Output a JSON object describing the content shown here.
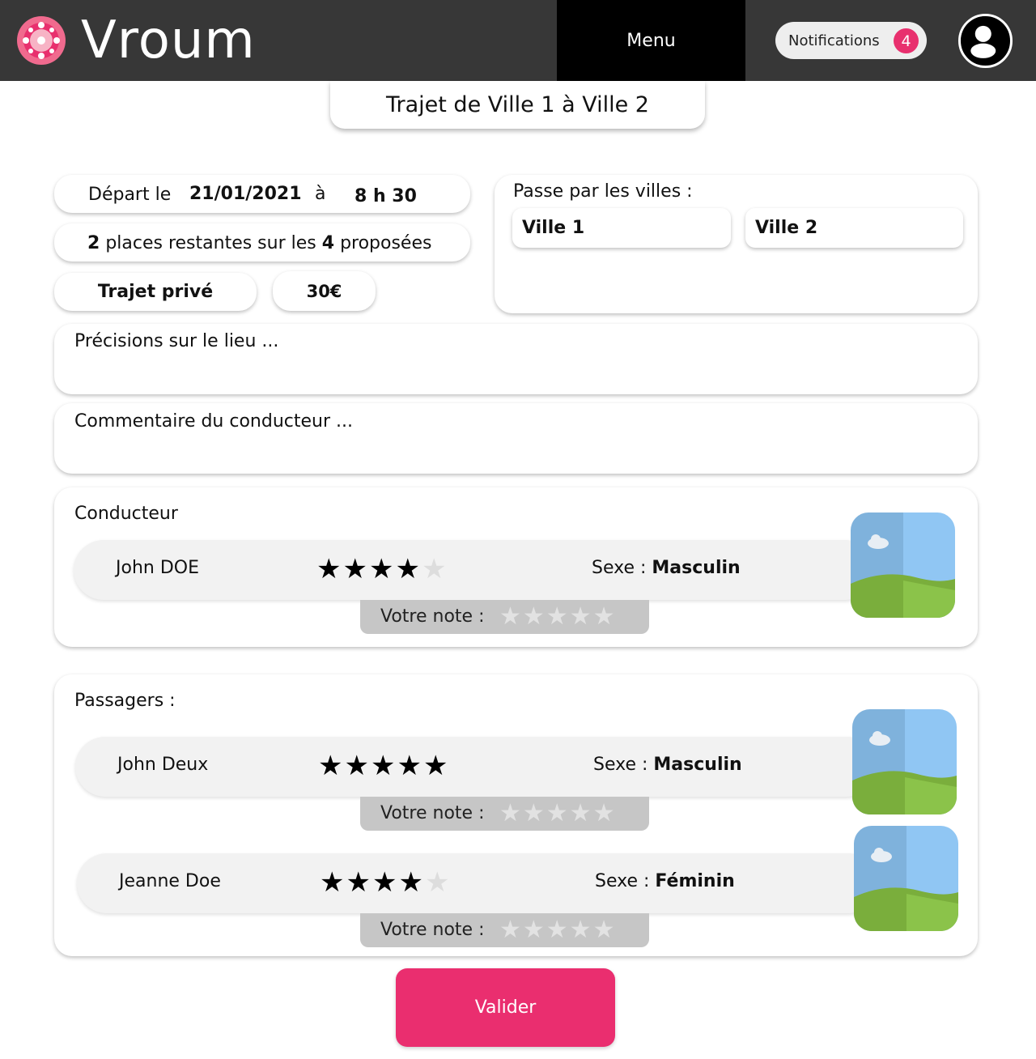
{
  "header": {
    "app_name": "Vroum",
    "menu_label": "Menu",
    "notifications_label": "Notifications",
    "notifications_count": "4",
    "accent_color": "#ea2e6f"
  },
  "trip": {
    "title": "Trajet de Ville 1 à Ville 2",
    "departure_label": "Départ le",
    "departure_date": "21/01/2021",
    "at_label": "à",
    "departure_time": "8 h 30",
    "seats_remaining": "2",
    "seats_text_1": "places restantes sur les",
    "seats_total": "4",
    "seats_text_2": "proposées",
    "privacy": "Trajet privé",
    "price": "30€",
    "cities_label": "Passe par les villes :",
    "cities": [
      "Ville 1",
      "Ville 2"
    ],
    "location_details_placeholder": "Précisions sur le lieu ...",
    "driver_comment_placeholder": "Commentaire du conducteur ..."
  },
  "driver": {
    "section_label": "Conducteur",
    "name": "John DOE",
    "rating": 4,
    "sexe_label": "Sexe :",
    "sexe": "Masculin",
    "your_rating_label": "Votre note :"
  },
  "passengers": {
    "section_label": "Passagers :",
    "items": [
      {
        "name": "John Deux",
        "rating": 5,
        "sexe_label": "Sexe :",
        "sexe": "Masculin",
        "your_rating_label": "Votre note :"
      },
      {
        "name": "Jeanne Doe",
        "rating": 4,
        "sexe_label": "Sexe :",
        "sexe": "Féminin",
        "your_rating_label": "Votre note :"
      }
    ]
  },
  "actions": {
    "submit_label": "Valider"
  }
}
